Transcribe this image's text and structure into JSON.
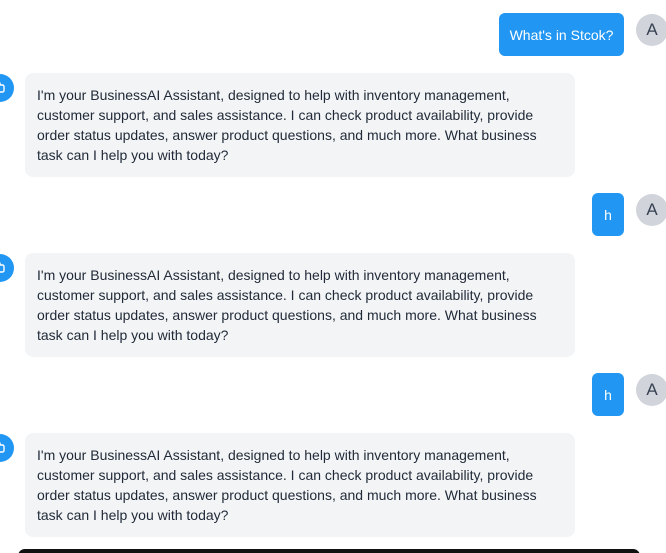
{
  "messages": [
    {
      "role": "user",
      "text": "What's in Stcok?",
      "avatar": "A"
    },
    {
      "role": "assistant",
      "text": "I'm your BusinessAI Assistant, designed to help with inventory management, customer support, and sales assistance. I can check product availability, provide order status updates, answer product questions, and much more. What business task can I help you with today?",
      "icon": "bot-icon"
    },
    {
      "role": "user",
      "text": "h",
      "avatar": "A"
    },
    {
      "role": "assistant",
      "text": "I'm your BusinessAI Assistant, designed to help with inventory management, customer support, and sales assistance. I can check product availability, provide order status updates, answer product questions, and much more. What business task can I help you with today?",
      "icon": "bot-icon"
    },
    {
      "role": "user",
      "text": "h",
      "avatar": "A"
    },
    {
      "role": "assistant",
      "text": "I'm your BusinessAI Assistant, designed to help with inventory management, customer support, and sales assistance. I can check product availability, provide order status updates, answer product questions, and much more. What business task can I help you with today?",
      "icon": "bot-icon"
    }
  ],
  "colors": {
    "user_bubble": "#2196f3",
    "assistant_bubble": "#f3f4f6",
    "avatar_bg": "#d1d5db"
  }
}
